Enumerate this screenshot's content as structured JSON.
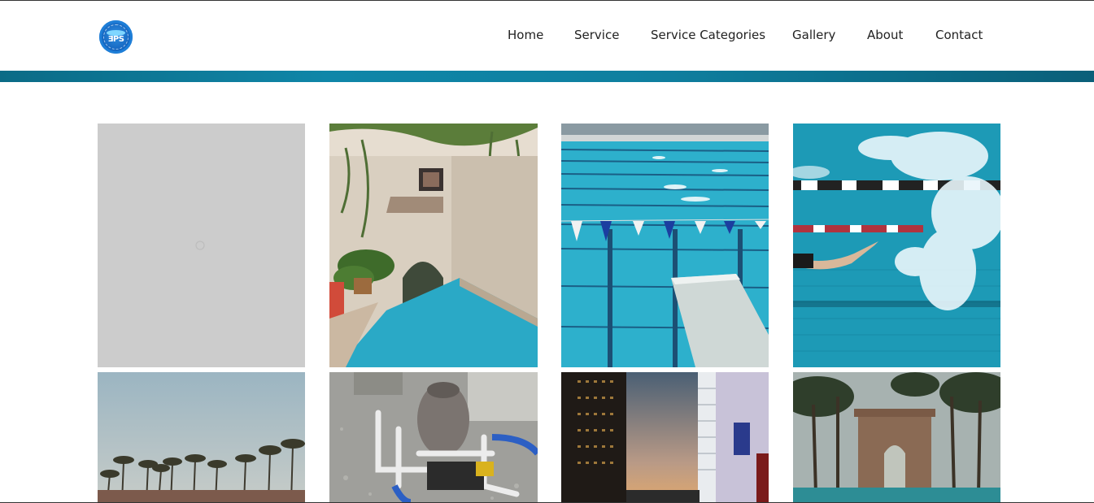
{
  "header": {
    "logo_icon": "tps-pool-logo-icon",
    "nav": [
      {
        "label": "Home"
      },
      {
        "label": "Service"
      },
      {
        "label": "Service Categories"
      },
      {
        "label": "Gallery"
      },
      {
        "label": "About"
      },
      {
        "label": "Contact"
      }
    ]
  },
  "colors": {
    "band": "#0e7f9f",
    "placeholder": "#cccccc",
    "pool_water": "#2aa9c6"
  },
  "gallery": {
    "images": [
      {
        "subject": "loading-placeholder"
      },
      {
        "subject": "courtyard-pool-with-arch"
      },
      {
        "subject": "lap-pool-with-flags-and-diving-board"
      },
      {
        "subject": "swimmer-underwater-splash"
      },
      {
        "subject": "palm-trees-sky"
      },
      {
        "subject": "pool-filter-pump-equipment"
      },
      {
        "subject": "city-buildings-sunset"
      },
      {
        "subject": "palm-garden-archway-pool"
      }
    ]
  }
}
